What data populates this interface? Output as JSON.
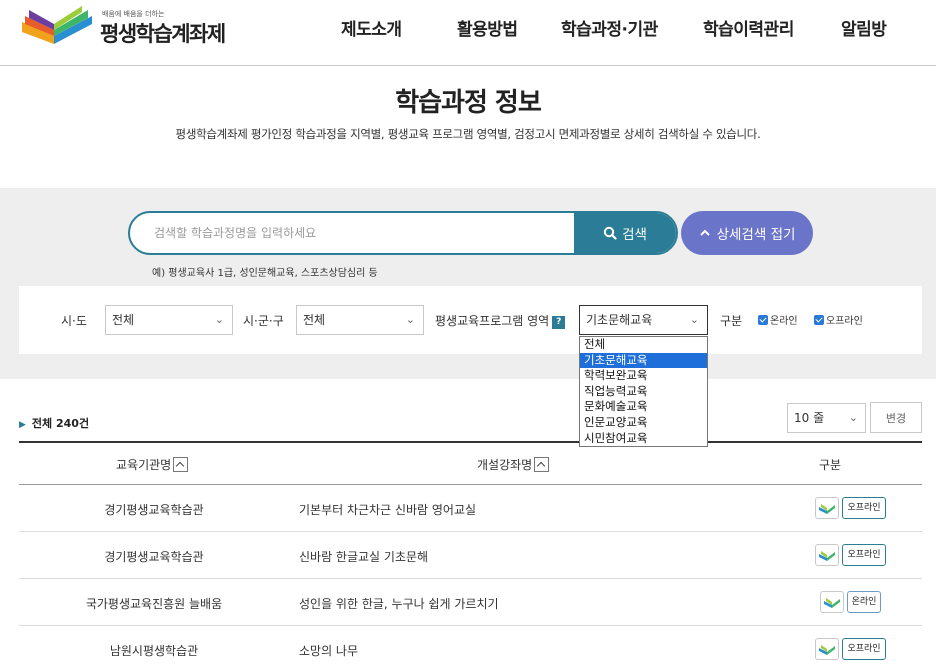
{
  "header": {
    "logo_tagline": "배움에 배움을 더하는",
    "logo_name": "평생학습계좌제",
    "nav": [
      "제도소개",
      "활용방법",
      "학습과정·기관",
      "학습이력관리",
      "알림방"
    ]
  },
  "page": {
    "title": "학습과정 정보",
    "description": "평생학습계좌제 평가인정 학습과정을 지역별, 평생교육 프로그램 영역별, 검정고시 면제과정별로 상세히 검색하실 수 있습니다."
  },
  "search": {
    "placeholder": "검색할 학습과정명을 입력하세요",
    "button_label": "검색",
    "detail_toggle_label": "상세검색 접기",
    "hint": "예) 평생교육사 1급, 성인문해교육, 스포츠상담심리 등"
  },
  "filters": {
    "sido_label": "시·도",
    "sido_value": "전체",
    "sigungu_label": "시·군·구",
    "sigungu_value": "전체",
    "program_label": "평생교육프로그램 영역",
    "program_help": "?",
    "program_value": "기초문해교육",
    "program_options": [
      "전체",
      "기초문해교육",
      "학력보완교육",
      "직업능력교육",
      "문화예술교육",
      "인문교양교육",
      "시민참여교육"
    ],
    "program_selected_index": 1,
    "type_label": "구분",
    "online_label": "온라인",
    "offline_label": "오프라인",
    "online_checked": true,
    "offline_checked": true
  },
  "results": {
    "total_label": "전체 240건",
    "rows_per_page": "10 줄",
    "change_label": "변경"
  },
  "table": {
    "headers": {
      "institution": "교육기관명",
      "course": "개설강좌명",
      "type": "구분"
    },
    "rows": [
      {
        "institution": "경기평생교육학습관",
        "course": "기본부터 차근차근 신바람 영어교실",
        "type": "오프라인"
      },
      {
        "institution": "경기평생교육학습관",
        "course": "신바람 한글교실 기초문해",
        "type": "오프라인"
      },
      {
        "institution": "국가평생교육진흥원 늘배움",
        "course": "성인을 위한 한글, 누구나 쉽게 가르치기",
        "type": "온라인"
      },
      {
        "institution": "남원시평생학습관",
        "course": "소망의 나무",
        "type": "오프라인"
      }
    ]
  },
  "colors": {
    "primary": "#2a7c97",
    "detail_button": "#6a74c9",
    "dropdown_highlight": "#1e6fd9",
    "search_area_bg": "#eeeeee"
  }
}
